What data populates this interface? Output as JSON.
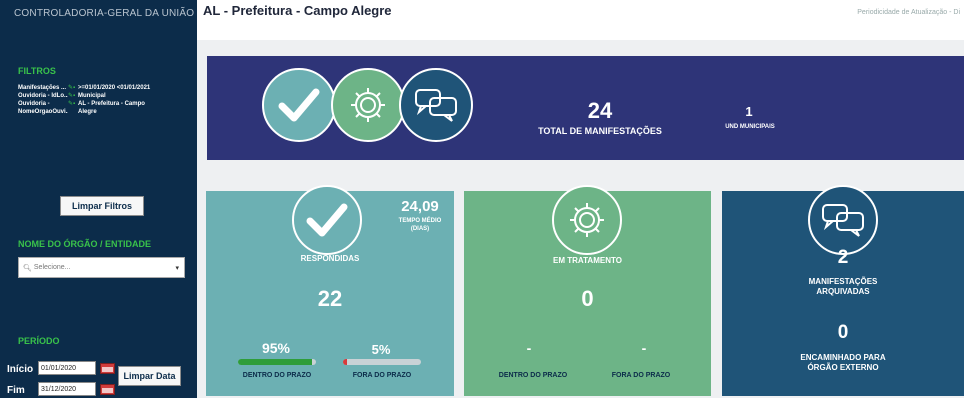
{
  "sidebar": {
    "header": "CONTROLADORIA-GERAL DA UNIÃO",
    "filters_title": "FILTROS",
    "filters": [
      {
        "key": "Manifestações ...",
        "value": ">=01/01/2020 <01/01/2021"
      },
      {
        "key": "Ouvidoria - IdLo...",
        "value": "Municipal"
      },
      {
        "key": "Ouvidoria -",
        "value": "AL - Prefeitura - Campo"
      },
      {
        "key": "NomeOrgaoOuvi...",
        "value": "Alegre"
      }
    ],
    "clear_filters_label": "Limpar Filtros",
    "org_title": "NOME DO ÓRGÃO / ENTIDADE",
    "org_select_placeholder": "Selecione...",
    "period_title": "PERÍODO",
    "start_label": "Início",
    "start_value": "01/01/2020",
    "end_label": "Fim",
    "end_value": "31/12/2020",
    "clear_date_label": "Limpar Data"
  },
  "topbar": {
    "title": "AL - Prefeitura - Campo Alegre",
    "right_text": "Periodicidade de Atualização - Di"
  },
  "banner": {
    "total_value": "24",
    "total_label": "TOTAL DE MANIFESTAÇÕES",
    "und_value": "1",
    "und_label": "UND MUNICIPAIS"
  },
  "cards": {
    "responded": {
      "title": "RESPONDIDAS",
      "value": "22",
      "avg_value": "24,09",
      "avg_label_1": "TEMPO MÉDIO",
      "avg_label_2": "(DIAS)",
      "in_pct": "95%",
      "out_pct": "5%",
      "in_fraction": 0.95,
      "out_fraction": 0.05,
      "in_label": "DENTRO DO PRAZO",
      "out_label": "FORA DO PRAZO"
    },
    "treatment": {
      "title": "EM TRATAMENTO",
      "value": "0",
      "in_value": "-",
      "out_value": "-",
      "in_label": "DENTRO DO PRAZO",
      "out_label": "FORA DO PRAZO"
    },
    "archived": {
      "value": "2",
      "label_1": "MANIFESTAÇÕES",
      "label_2": "ARQUIVADAS",
      "fwd_value": "0",
      "fwd_label_1": "ENCAMINHADO PARA",
      "fwd_label_2": "ÓRGÃO EXTERNO"
    }
  },
  "colors": {
    "sidebar": "#0c2c4a",
    "banner": "#2e3478",
    "card_responded": "#6cb0b3",
    "card_treatment": "#6db487",
    "card_archived": "#1f5478",
    "accent_green": "#39c24a",
    "bar_green": "#2f9d3a",
    "bar_red": "#d83a3a"
  },
  "icons": [
    "check-icon",
    "gear-icon",
    "chat-icon",
    "calendar-icon",
    "chevron-down-icon",
    "search-icon",
    "edit-icon",
    "filter-icon"
  ]
}
